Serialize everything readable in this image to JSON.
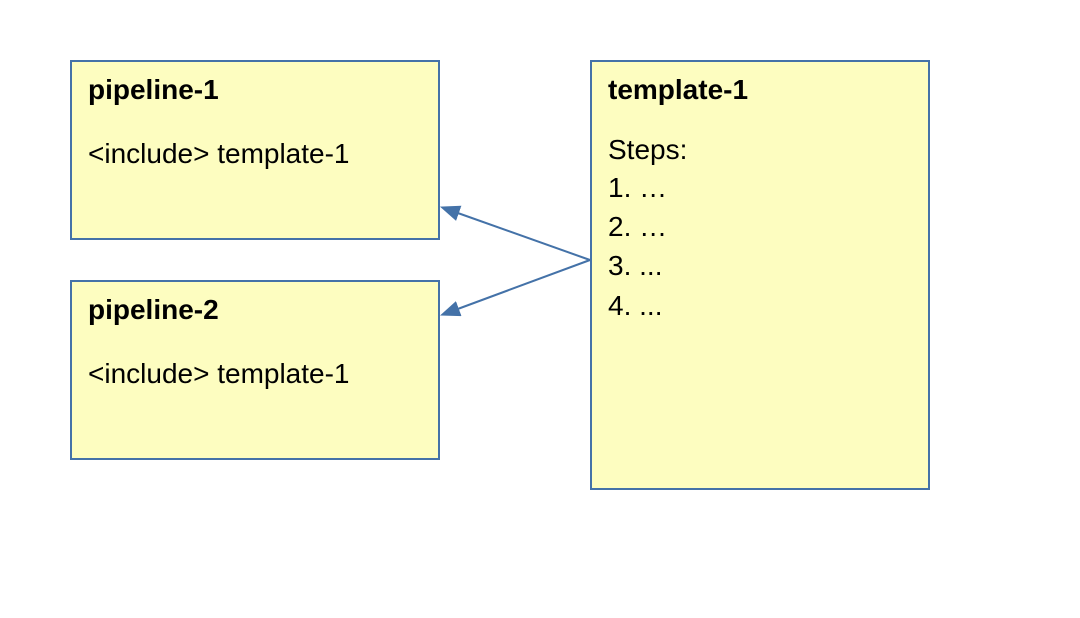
{
  "colors": {
    "box_fill": "#fdfdc0",
    "box_border": "#4472a8",
    "arrow": "#4472a8"
  },
  "boxes": {
    "pipeline1": {
      "title": "pipeline-1",
      "content": "<include> template-1"
    },
    "pipeline2": {
      "title": "pipeline-2",
      "content": "<include> template-1"
    },
    "template1": {
      "title": "template-1",
      "steps_label": "Steps:",
      "steps": [
        "1. …",
        "2. …",
        "3. ...",
        "4. ..."
      ]
    }
  },
  "arrows": [
    {
      "from": "template1",
      "to": "pipeline1"
    },
    {
      "from": "template1",
      "to": "pipeline2"
    }
  ]
}
